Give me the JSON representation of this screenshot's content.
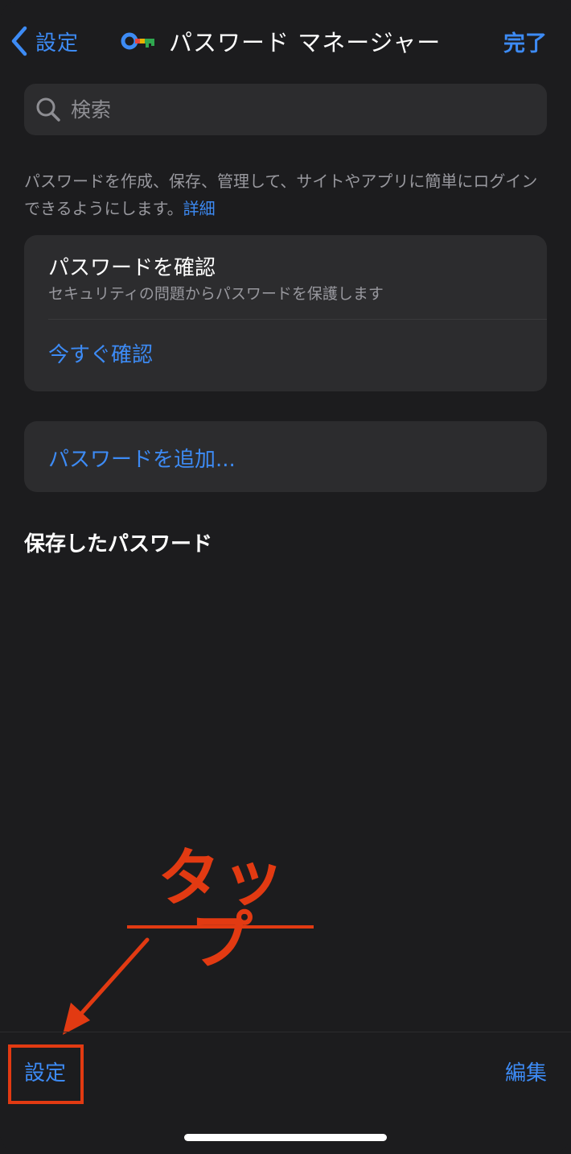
{
  "nav": {
    "back_label": "設定",
    "title": "パスワード マネージャー",
    "done_label": "完了"
  },
  "search": {
    "placeholder": "検索"
  },
  "description": {
    "text": "パスワードを作成、保存、管理して、サイトやアプリに簡単にログインできるようにします。",
    "link": "詳細"
  },
  "check_card": {
    "title": "パスワードを確認",
    "subtitle": "セキュリティの問題からパスワードを保護します",
    "action": "今すぐ確認"
  },
  "add_password": {
    "label": "パスワードを追加..."
  },
  "saved_section": {
    "heading": "保存したパスワード"
  },
  "annotation": {
    "text": "タップ"
  },
  "toolbar": {
    "settings_label": "設定",
    "edit_label": "編集"
  },
  "colors": {
    "background": "#1c1c1e",
    "card": "#2c2c2e",
    "accent": "#3d8bf5",
    "annotation": "#e23a12"
  },
  "icons": {
    "back": "chevron-left-icon",
    "app": "key-icon",
    "search": "search-icon"
  }
}
